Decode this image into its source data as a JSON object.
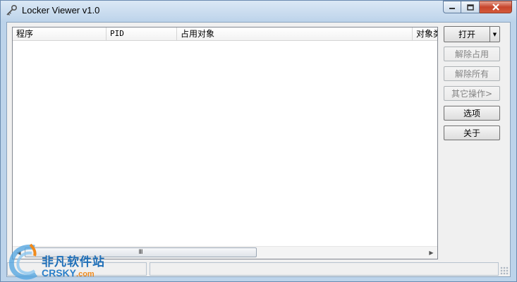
{
  "window": {
    "title": "Locker Viewer v1.0",
    "icon": "key-icon"
  },
  "listview": {
    "columns": [
      {
        "label": "程序"
      },
      {
        "label": "PID"
      },
      {
        "label": "占用对象"
      },
      {
        "label": "对象类型"
      }
    ],
    "rows": [],
    "scroll_grip": "Ⅲ"
  },
  "buttons": {
    "open": {
      "label": "打开",
      "enabled": true
    },
    "unlock": {
      "label": "解除占用",
      "enabled": false
    },
    "unlock_all": {
      "label": "解除所有",
      "enabled": false
    },
    "other_ops": {
      "label": "其它操作>",
      "enabled": false
    },
    "options": {
      "label": "选项",
      "enabled": true
    },
    "about": {
      "label": "关于",
      "enabled": true
    }
  },
  "watermark": {
    "cn": "非凡软件站",
    "en_main": "CRSKY",
    "en_suffix": ".com"
  },
  "colors": {
    "titlebar": "#bcd3ea",
    "close_button": "#c7452c",
    "watermark_blue": "#1f6fb8",
    "watermark_orange": "#f08a1c"
  }
}
